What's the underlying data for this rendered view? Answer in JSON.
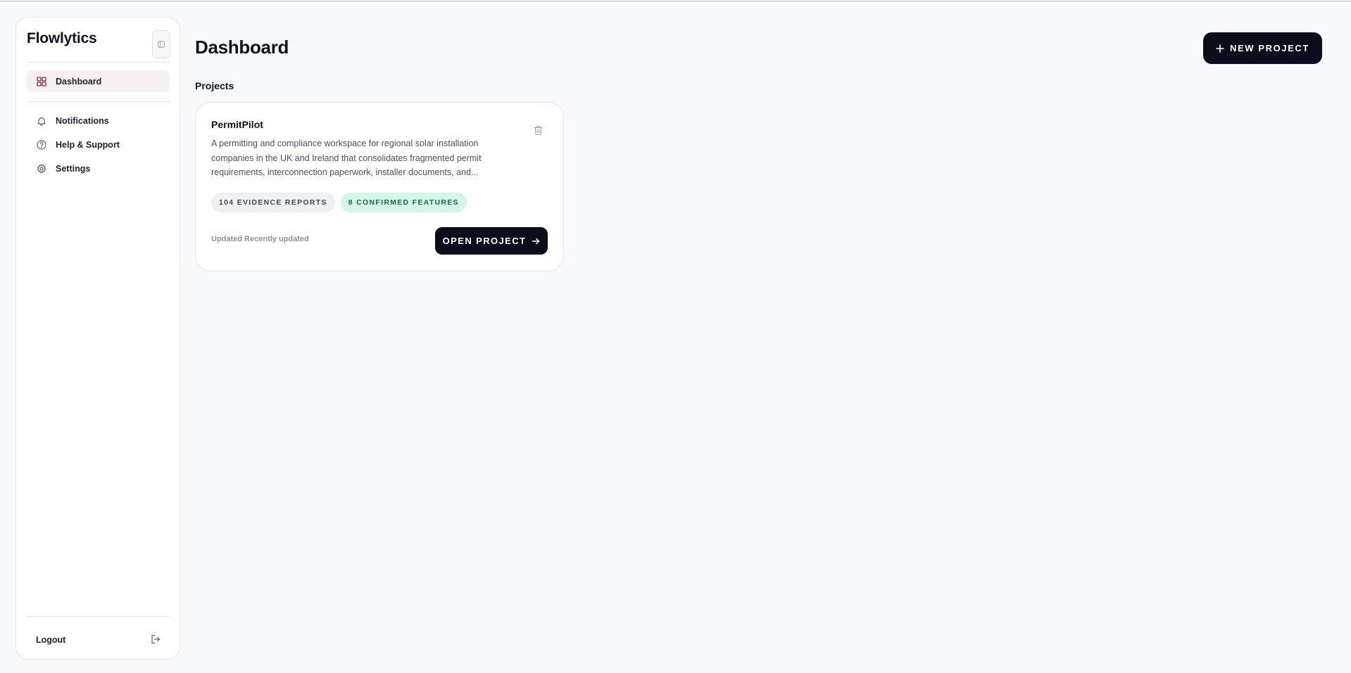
{
  "app": {
    "brand": "Flowlytics"
  },
  "sidebar": {
    "primary": [
      {
        "label": "Dashboard",
        "icon": "grid-icon",
        "active": true
      }
    ],
    "secondary": [
      {
        "label": "Notifications",
        "icon": "bell-icon"
      },
      {
        "label": "Help & Support",
        "icon": "help-circle-icon"
      },
      {
        "label": "Settings",
        "icon": "gear-icon"
      }
    ],
    "logout_label": "Logout"
  },
  "header": {
    "title": "Dashboard",
    "new_project_label": "NEW PROJECT"
  },
  "projects": {
    "section_title": "Projects",
    "items": [
      {
        "name": "PermitPilot",
        "description": "A permitting and compliance workspace for regional solar installation companies in the UK and Ireland that consolidates fragmented permit requirements, interconnection paperwork, installer documents, and...",
        "badge_reports": "104 EVIDENCE REPORTS",
        "badge_features": "8 CONFIRMED FEATURES",
        "updated": "Updated Recently updated",
        "open_label": "OPEN PROJECT"
      }
    ]
  },
  "colors": {
    "background": "#f8f9fb",
    "primary_button": "#0b0d1c",
    "active_nav": "#f6f0f2",
    "accent_icon": "#7a2a44",
    "green_badge_bg": "#d4f5e7",
    "green_badge_text": "#16684d"
  }
}
